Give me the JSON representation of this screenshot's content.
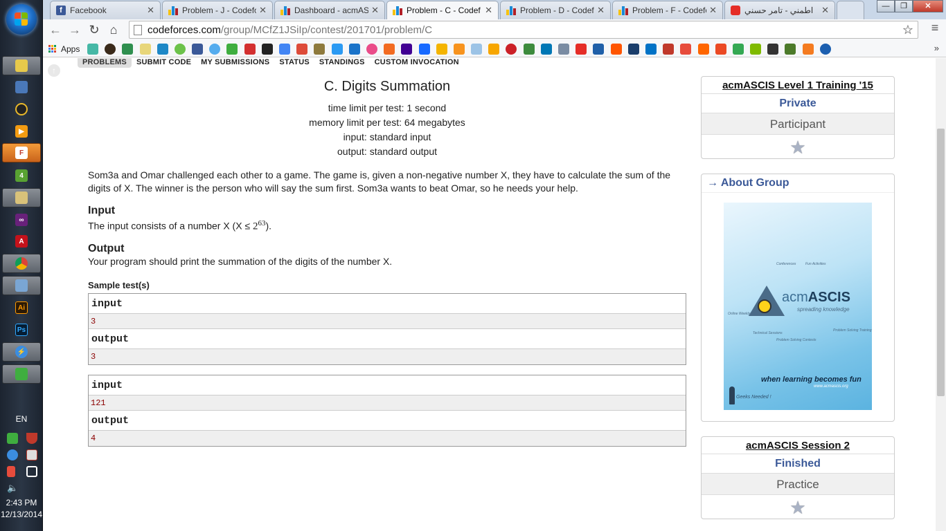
{
  "taskbar": {
    "tray_lang": "EN",
    "clock_time": "2:43 PM",
    "clock_date": "12/13/2014"
  },
  "tabs": [
    {
      "title": "Facebook",
      "icon": "facebook-icon"
    },
    {
      "title": "Problem - J - Codefo",
      "icon": "codeforces-icon"
    },
    {
      "title": "Dashboard - acmASC",
      "icon": "codeforces-icon"
    },
    {
      "title": "Problem - C - Codef",
      "icon": "codeforces-icon",
      "active": true
    },
    {
      "title": "Problem - D - Codef",
      "icon": "codeforces-icon"
    },
    {
      "title": "Problem - F - Codefo",
      "icon": "codeforces-icon"
    },
    {
      "title": "اطمني - تامر حسني",
      "icon": "youtube-icon"
    }
  ],
  "address": {
    "host": "codeforces.com",
    "path": "/group/MCfZ1JSiIp/contest/201701/problem/C"
  },
  "bookmarks": {
    "apps_label": "Apps",
    "more_label": "»"
  },
  "nav": {
    "items": [
      "PROBLEMS",
      "SUBMIT CODE",
      "MY SUBMISSIONS",
      "STATUS",
      "STANDINGS",
      "CUSTOM INVOCATION"
    ]
  },
  "problem": {
    "title": "C. Digits Summation",
    "time_limit": "time limit per test: 1 second",
    "memory_limit": "memory limit per test: 64 megabytes",
    "input_file": "input: standard input",
    "output_file": "output: standard output",
    "statement": "Som3a and Omar challenged each other to a game. The game is, given a non-negative number X, they have to calculate the sum of the digits of X. The winner is the person who will say the sum first. Som3a wants to beat Omar, so he needs your help.",
    "input_title": "Input",
    "input_text_prefix": "The input consists of a number X (X ≤ ",
    "input_base": "2",
    "input_exp": "63",
    "input_text_suffix": ").",
    "output_title": "Output",
    "output_text": "Your program should print the summation of the digits of the number X.",
    "samples_title": "Sample test(s)",
    "input_label": "input",
    "output_label": "output",
    "samples": [
      {
        "input": "3",
        "output": "3"
      },
      {
        "input": "121",
        "output": "4"
      }
    ]
  },
  "sidebar": {
    "training": {
      "name": "acmASCIS Level 1 Training '15",
      "status": "Private",
      "role": "Participant"
    },
    "about": {
      "title": "→ About Group",
      "poster_brand_prefix": "acm",
      "poster_brand": "ASCIS",
      "poster_tagline": "spreading knowledge",
      "poster_slogan": "when learning becomes fun",
      "poster_url": "www.acmascis.org",
      "poster_geeks": "Geeks Needed !",
      "poster_labels": [
        "Conferences",
        "Fun Activities",
        "Online Weekly Posts",
        "Technical Sessions",
        "Problem Solving Contests",
        "Problem Solving Training"
      ]
    },
    "session": {
      "name": "acmASCIS Session 2",
      "status": "Finished",
      "role": "Practice"
    }
  }
}
